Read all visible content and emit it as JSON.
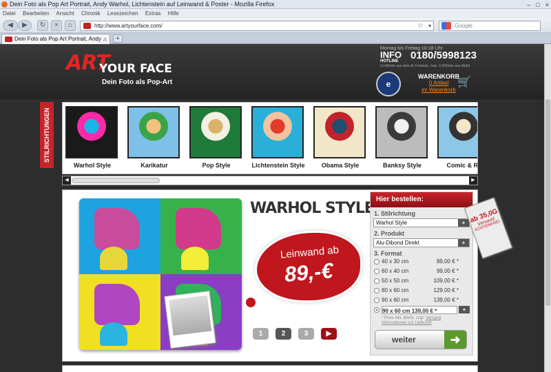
{
  "browser": {
    "title": "Dein Foto als Pop Art Portrait, Andy Warhol, Lichtenstein auf Leinwand & Poster - Mozilla Firefox",
    "menu": [
      "Datei",
      "Bearbeiten",
      "Ansicht",
      "Chronik",
      "Lesezeichen",
      "Extras",
      "Hilfe"
    ],
    "url": "http://www.artyourface.com/",
    "search_placeholder": "Google",
    "tab_title": "Dein Foto als Pop Art Portrait, Andy ...",
    "new_tab": "+",
    "close": "×"
  },
  "header": {
    "logo_art": "ART",
    "logo_yourface": "YOUR FACE",
    "logo_sub": "Dein Foto als Pop-Art",
    "hotline_hours": "Montag bis Freitag 10-18 Uhr",
    "hotline_info": "INFO",
    "hotline_label": "HOTLINE",
    "hotline_number": "0180/5998123",
    "hotline_price": "0,14€/min aus dem dt. Festnetz, max. 0,42€/min aus Mobil",
    "trusted": "e",
    "cart_title": "WARENKORB",
    "cart_count": "0 Artikel",
    "cart_link": "im Warenkorb"
  },
  "sidetab": "STILRICHTUNGEN",
  "styles": [
    {
      "label": "Warhol Style",
      "bg": "#1a1a1a",
      "c1": "#ff2aa8",
      "c2": "#19b5e8"
    },
    {
      "label": "Karikatur",
      "bg": "#7ec0e8",
      "c1": "#3aa348",
      "c2": "#f1c27d"
    },
    {
      "label": "Pop Style",
      "bg": "#1f7b3a",
      "c1": "#f3f1e4",
      "c2": "#d8b36a"
    },
    {
      "label": "Lichtenstein Style",
      "bg": "#2ab0d8",
      "c1": "#f3c3a0",
      "c2": "#e23b2c"
    },
    {
      "label": "Obama Style",
      "bg": "#f1e6c8",
      "c1": "#c0232a",
      "c2": "#1e4e70"
    },
    {
      "label": "Banksy Style",
      "bg": "#bcbcbc",
      "c1": "#3a3a3a",
      "c2": "#f0f0f0"
    },
    {
      "label": "Comic & Ro",
      "bg": "#8cc7e8",
      "c1": "#333",
      "c2": "#f3e6c8"
    }
  ],
  "product": {
    "title": "WARHOL STYLE",
    "price_line1": "Leinwand ab",
    "price_line2": "89,-€",
    "pages": [
      "1",
      "2",
      "3"
    ],
    "play": "▶"
  },
  "order": {
    "header": "Hier bestellen:",
    "sec1": "1. Stilrichtung",
    "style_value": "Warhol Style",
    "sec2": "2. Produkt",
    "product_value": "Alu-Dibond Direkt",
    "sec3": "3. Format",
    "formats": [
      {
        "size": "40 x 30 cm",
        "price": "89,00 € *"
      },
      {
        "size": "60 x 40 cm",
        "price": "99,00 € *"
      },
      {
        "size": "50 x 50 cm",
        "price": "109,00 € *"
      },
      {
        "size": "80 x 60 cm",
        "price": "129,00 € *"
      },
      {
        "size": "90 x 60 cm",
        "price": "139,00 € *"
      }
    ],
    "selected_format": "90 x 60 cm    139,00 € *",
    "plus": "+",
    "note1": "* Preis inkl. MwSt. zzgl.",
    "note_link1": "Versand",
    "note_link2": "Informationen zur Lieferzeit",
    "button": "weiter",
    "arrow": "➜"
  },
  "tag": {
    "a": "ab 35,0G",
    "b": "Versand",
    "c": "KOSTENFREI"
  }
}
